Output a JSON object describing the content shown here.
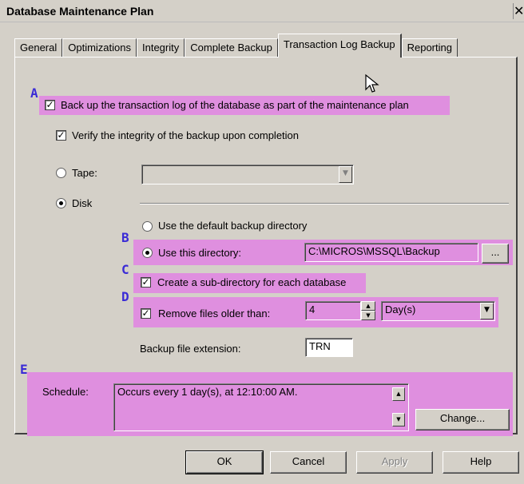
{
  "window": {
    "title": "Database Maintenance Plan",
    "close_glyph": "✕"
  },
  "tabs": [
    {
      "label": "General"
    },
    {
      "label": "Optimizations"
    },
    {
      "label": "Integrity"
    },
    {
      "label": "Complete Backup"
    },
    {
      "label": "Transaction Log Backup",
      "active": true
    },
    {
      "label": "Reporting"
    }
  ],
  "annotations": {
    "a": "A",
    "b": "B",
    "c": "C",
    "d": "D",
    "e": "E"
  },
  "options": {
    "backup_log": {
      "label": "Back up the transaction log of the database as part of the maintenance plan",
      "checked": true
    },
    "verify": {
      "label": "Verify the integrity of the backup upon completion",
      "checked": true
    }
  },
  "destination": {
    "tape_label": "Tape:",
    "tape_value": "",
    "disk_label": "Disk",
    "selected": "Disk"
  },
  "directory": {
    "default_label": "Use the default backup directory",
    "this_label": "Use this directory:",
    "path": "C:\\MICROS\\MSSQL\\Backup",
    "browse_label": "...",
    "selected": "Use this directory"
  },
  "subdir": {
    "label": "Create a sub-directory for each database",
    "checked": true
  },
  "remove_old": {
    "label": "Remove files older than:",
    "checked": true,
    "value": "4",
    "unit": "Day(s)"
  },
  "extension": {
    "label": "Backup file extension:",
    "value": "TRN"
  },
  "schedule": {
    "label": "Schedule:",
    "text": "Occurs every 1 day(s), at 12:10:00 AM.",
    "change_label": "Change..."
  },
  "footer": {
    "ok": "OK",
    "cancel": "Cancel",
    "apply": "Apply",
    "help": "Help"
  },
  "colors": {
    "highlight": "#df8fdf",
    "annotation_letter": "#3a2bd6",
    "dialog_face": "#d4d0c8"
  },
  "glyphs": {
    "check": "✓",
    "down": "▼",
    "up": "▲"
  }
}
